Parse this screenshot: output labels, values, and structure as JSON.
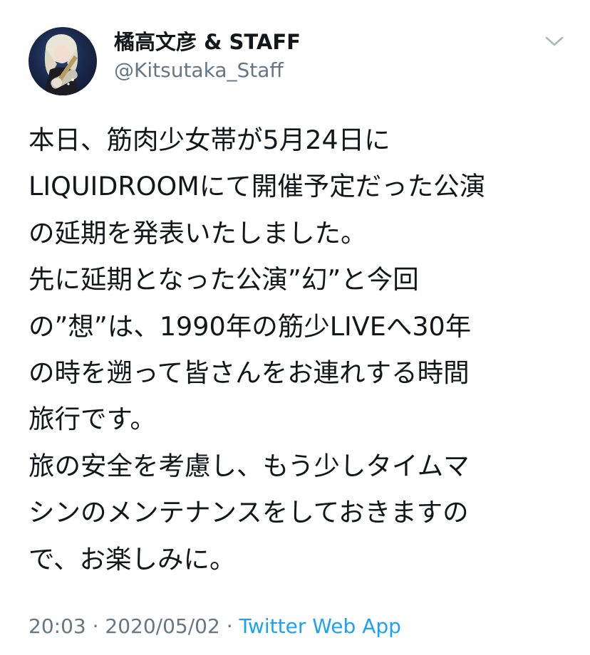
{
  "author": {
    "display_name": "橘高文彦 & STAFF",
    "handle": "@Kitsutaka_Staff"
  },
  "icons": {
    "avatar": "profile-photo",
    "more": "chevron-down-icon"
  },
  "tweet": {
    "lines": [
      "本日、筋肉少女帯が5月24日に",
      "LIQUIDROOMにて開催予定だった公演",
      "の延期を発表いたしました。",
      "先に延期となった公演”幻”と今回",
      "の”想”は、1990年の筋少LIVEへ30年",
      "の時を遡って皆さんをお連れする時間",
      "旅行です。",
      "旅の安全を考慮し、もう少しタイムマ",
      "シンのメンテナンスをしておきますの",
      "で、お楽しみに。"
    ]
  },
  "meta": {
    "time": "20:03",
    "separator": " · ",
    "date": "2020/05/02",
    "source": "Twitter Web App"
  },
  "colors": {
    "text": "#14171a",
    "secondary": "#657786",
    "link": "#1da1f2",
    "chevron": "#aab8c2"
  }
}
